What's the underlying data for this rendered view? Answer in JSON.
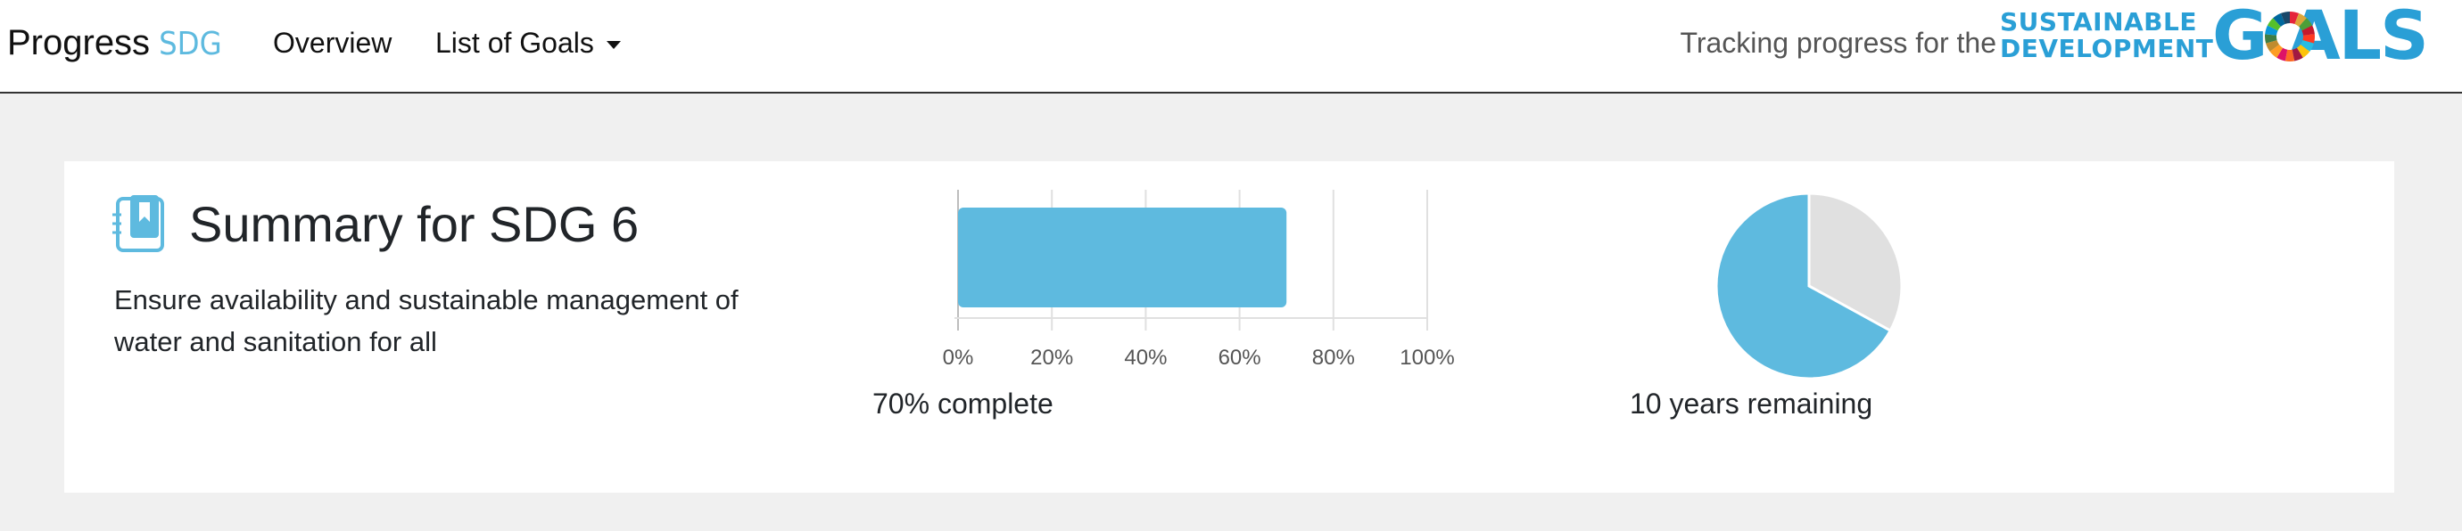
{
  "navbar": {
    "brand": "Progress",
    "brand_accent": "SDG",
    "links": [
      {
        "label": "Overview"
      },
      {
        "label": "List of Goals"
      }
    ],
    "tracking_text": "Tracking progress for the",
    "logo_line1": "SUSTAINABLE",
    "logo_line2": "DEVELOPMENT",
    "logo_goals": "G  ALS"
  },
  "summary": {
    "title": "Summary for SDG 6",
    "description": "Ensure availability and sustainable management of water and sanitation for all",
    "progress_caption": "70% complete",
    "remaining_caption": "10 years remaining"
  },
  "colors": {
    "accent": "#5ebadf",
    "pie_rest": "#e0e0e0"
  },
  "chart_data": [
    {
      "type": "bar",
      "orientation": "horizontal",
      "categories": [
        ""
      ],
      "values": [
        70
      ],
      "xlim": [
        0,
        100
      ],
      "tick_labels": [
        "0%",
        "20%",
        "40%",
        "60%",
        "80%",
        "100%"
      ],
      "grid": true
    },
    {
      "type": "pie",
      "values": [
        67,
        33
      ],
      "colors": [
        "#5ebadf",
        "#e0e0e0"
      ]
    }
  ]
}
